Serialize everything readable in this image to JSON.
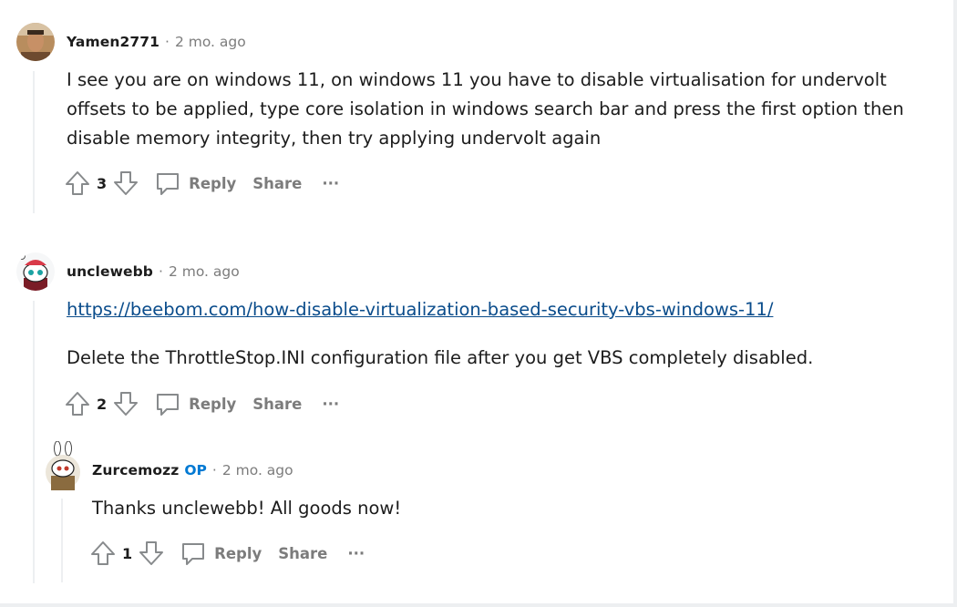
{
  "comments": [
    {
      "username": "Yamen2771",
      "separator": "·",
      "time": "2 mo. ago",
      "lines": [
        "I see you are on windows 11, on windows 11 you have to disable virtualisation for undervolt",
        "offsets to be applied, type core isolation in windows search bar and press the first option then",
        "disable memory integrity, then try applying undervolt again"
      ],
      "votes": "3",
      "reply_label": "Reply",
      "share_label": "Share",
      "more_label": "···",
      "avatar_color": "#c49a6c"
    },
    {
      "username": "unclewebb",
      "separator": "·",
      "time": "2 mo. ago",
      "link": "https://beebom.com/how-disable-virtualization-based-security-vbs-windows-11/",
      "text": "Delete the ThrottleStop.INI configuration file after you get VBS completely disabled.",
      "votes": "2",
      "reply_label": "Reply",
      "share_label": "Share",
      "more_label": "···",
      "avatar_color": "#d93a49"
    },
    {
      "username": "Zurcemozz",
      "op_label": "OP",
      "separator": "·",
      "time": "2 mo. ago",
      "text": "Thanks unclewebb! All goods now!",
      "votes": "1",
      "reply_label": "Reply",
      "share_label": "Share",
      "more_label": "···",
      "avatar_color": "#8a6b3f"
    }
  ],
  "colors": {
    "link": "#0a4c8b",
    "op": "#0079d3",
    "muted": "#7c7c7c",
    "thread_line": "#edeff1"
  }
}
